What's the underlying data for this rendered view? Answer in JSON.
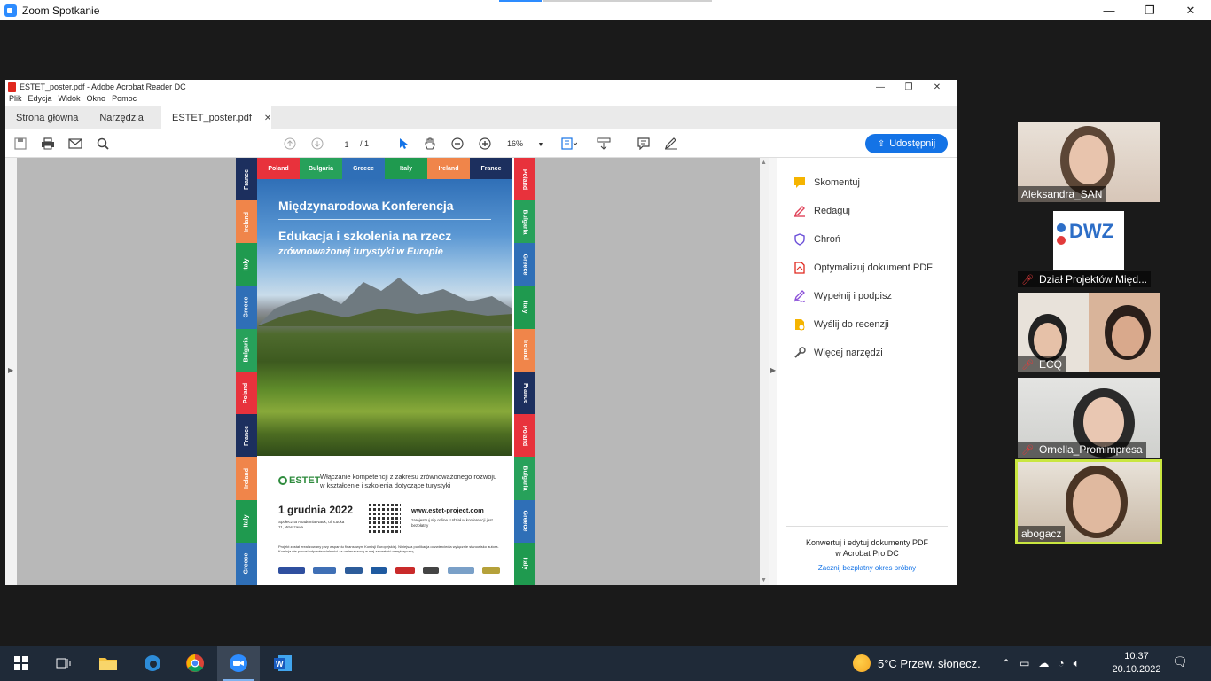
{
  "zoom": {
    "title": "Zoom Spotkanie",
    "minimize": "—",
    "maximize": "❐",
    "close": "✕"
  },
  "acrobat": {
    "title": "ESTET_poster.pdf - Adobe Acrobat Reader DC",
    "menu": [
      "Plik",
      "Edycja",
      "Widok",
      "Okno",
      "Pomoc"
    ],
    "tabs": {
      "home": "Strona główna",
      "tools": "Narzędzia",
      "doc": "ESTET_poster.pdf"
    },
    "toolbar": {
      "page_current": "1",
      "page_total": "/ 1",
      "zoom": "16%",
      "share": "Udostępnij"
    },
    "tools": [
      {
        "label": "Skomentuj",
        "icon": "comment-icon",
        "color": "#f5b400"
      },
      {
        "label": "Redaguj",
        "icon": "redact-icon",
        "color": "#e0445a"
      },
      {
        "label": "Chroń",
        "icon": "shield-icon",
        "color": "#6b4fd8"
      },
      {
        "label": "Optymalizuj dokument PDF",
        "icon": "optimize-icon",
        "color": "#e0281e"
      },
      {
        "label": "Wypełnij i podpisz",
        "icon": "fill-sign-icon",
        "color": "#8b4fd8"
      },
      {
        "label": "Wyślij do recenzji",
        "icon": "review-icon",
        "color": "#f5b400"
      },
      {
        "label": "Więcej narzędzi",
        "icon": "more-tools-icon",
        "color": "#555555"
      }
    ],
    "promo": {
      "line1": "Konwertuj i edytuj dokumenty PDF",
      "line2": "w Acrobat Pro DC",
      "link": "Zacznij bezpłatny okres próbny"
    }
  },
  "poster": {
    "top_countries": [
      {
        "name": "Poland",
        "color": "#e8323c"
      },
      {
        "name": "Bulgaria",
        "color": "#27a15a"
      },
      {
        "name": "Greece",
        "color": "#2f6fb7"
      },
      {
        "name": "Italy",
        "color": "#1f9a4f"
      },
      {
        "name": "Ireland",
        "color": "#f0854a"
      },
      {
        "name": "France",
        "color": "#1c2f5e"
      }
    ],
    "left_countries": [
      {
        "name": "France",
        "color": "#1c2f5e"
      },
      {
        "name": "Ireland",
        "color": "#f0854a"
      },
      {
        "name": "Italy",
        "color": "#1f9a4f"
      },
      {
        "name": "Greece",
        "color": "#2f6fb7"
      },
      {
        "name": "Bulgaria",
        "color": "#27a15a"
      },
      {
        "name": "Poland",
        "color": "#e8323c"
      },
      {
        "name": "France",
        "color": "#1c2f5e"
      },
      {
        "name": "Ireland",
        "color": "#f0854a"
      },
      {
        "name": "Italy",
        "color": "#1f9a4f"
      },
      {
        "name": "Greece",
        "color": "#2f6fb7"
      }
    ],
    "right_countries": [
      {
        "name": "Poland",
        "color": "#e8323c"
      },
      {
        "name": "Bulgaria",
        "color": "#27a15a"
      },
      {
        "name": "Greece",
        "color": "#2f6fb7"
      },
      {
        "name": "Italy",
        "color": "#1f9a4f"
      },
      {
        "name": "Ireland",
        "color": "#f0854a"
      },
      {
        "name": "France",
        "color": "#1c2f5e"
      },
      {
        "name": "Poland",
        "color": "#e8323c"
      },
      {
        "name": "Bulgaria",
        "color": "#27a15a"
      },
      {
        "name": "Greece",
        "color": "#2f6fb7"
      },
      {
        "name": "Italy",
        "color": "#1f9a4f"
      }
    ],
    "title1": "Międzynarodowa Konferencja",
    "title2": "Edukacja i szkolenia na rzecz",
    "title3": "zrównoważonej turystyki w Europie",
    "logo": "ESTET",
    "tagline": "Włączanie kompetencji z zakresu zrównoważonego rozwoju w kształcenie i szkolenia dotyczące turystyki",
    "date": "1 grudnia 2022",
    "venue": "Społeczna Akademia Nauk, ul. Łucka 11, Warszawa",
    "url": "www.estet-project.com",
    "url_note": "zarejestruj się online. Udział w konferencji jest bezpłatny",
    "funding": "Projekt został zrealizowany przy wsparciu finansowym Komisji Europejskiej. Niniejsza publikacja odzwierciedla wyłącznie stanowisko autora. Komisja nie ponosi odpowiedzialności za umieszczoną w niej zawartość merytoryczną."
  },
  "participants": [
    {
      "name": "Aleksandra_SAN",
      "muted": false
    },
    {
      "name": "Dział Projektów Międ...",
      "muted": true
    },
    {
      "name": "ECQ",
      "muted": true
    },
    {
      "name": "Ornella_Promimpresa",
      "muted": true
    },
    {
      "name": "abogacz",
      "muted": false,
      "active": true
    }
  ],
  "dwz_logo": "DWZ",
  "taskbar": {
    "weather": "5°C  Przew. słonecz.",
    "time": "10:37",
    "date": "20.10.2022"
  }
}
